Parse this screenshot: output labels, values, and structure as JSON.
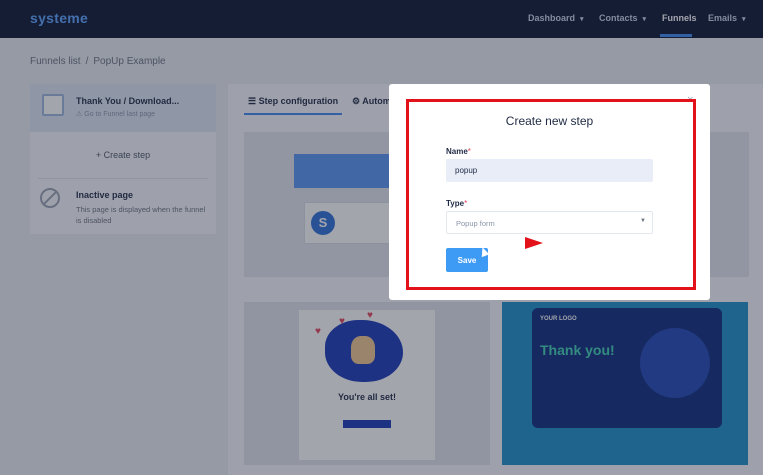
{
  "topnav": {
    "logo": "systeme",
    "items": [
      {
        "label": "Dashboard",
        "caret": "▾"
      },
      {
        "label": "Contacts",
        "caret": "▾"
      },
      {
        "label": "Funnels",
        "caret": ""
      },
      {
        "label": "Emails",
        "caret": "▾"
      }
    ],
    "active_item": "Funnels"
  },
  "breadcrumb": {
    "items": [
      "Funnels list",
      "PopUp Example"
    ],
    "separator": "/"
  },
  "steps": {
    "active_step": {
      "title": "Thank You / Download...",
      "subtitle": "⚠ Go to Funnel last page"
    },
    "create_step_label": "+   Create step",
    "inactive": {
      "title": "Inactive page",
      "description": "This page is displayed when the funnel is disabled"
    }
  },
  "tabs": [
    {
      "label": "☰ Step configuration",
      "active": true
    },
    {
      "label": "⚙ Autom",
      "active": false
    }
  ],
  "previews": {
    "left_heading": "You're all set!",
    "right_logo": "YOUR LOGO",
    "right_heading": "Thank you!"
  },
  "modal": {
    "title": "Create new step",
    "close_label": "×",
    "name_label": "Name",
    "name_value": "popup",
    "type_label": "Type",
    "type_value": "Popup form",
    "required_mark": "*",
    "save_label": "Save"
  },
  "colors": {
    "nav_bg": "#0c1530",
    "accent": "#3e88f0",
    "annotation": "#e3121a",
    "save_button": "#3e9bf5"
  }
}
